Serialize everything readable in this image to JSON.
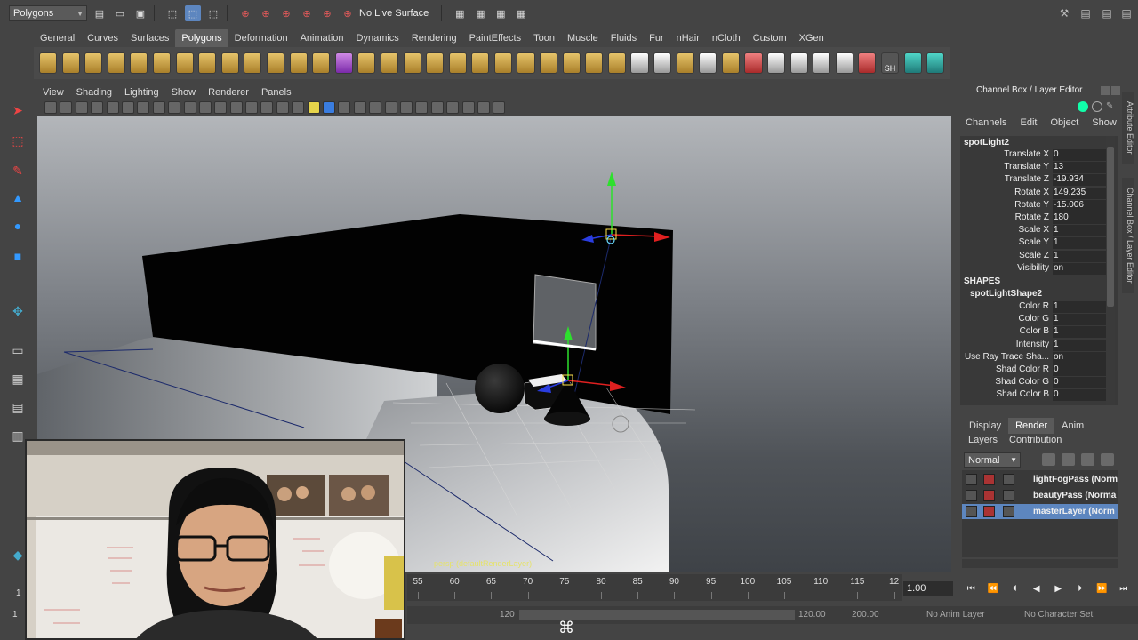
{
  "status": {
    "mode": "Polygons",
    "live_surface": "No Live Surface"
  },
  "shelf_tabs": [
    "General",
    "Curves",
    "Surfaces",
    "Polygons",
    "Deformation",
    "Animation",
    "Dynamics",
    "Rendering",
    "PaintEffects",
    "Toon",
    "Muscle",
    "Fluids",
    "Fur",
    "nHair",
    "nCloth",
    "Custom",
    "XGen"
  ],
  "shelf_active_tab": "Polygons",
  "shelf_sh_label": "SH",
  "panel_menus": [
    "View",
    "Shading",
    "Lighting",
    "Show",
    "Renderer",
    "Panels"
  ],
  "camera_label": "persp (defaultRenderLayer)",
  "channel_box": {
    "title": "Channel Box / Layer Editor",
    "menus": [
      "Channels",
      "Edit",
      "Object",
      "Show"
    ],
    "object_name": "spotLight2",
    "transform": [
      {
        "label": "Translate X",
        "value": "0"
      },
      {
        "label": "Translate Y",
        "value": "13"
      },
      {
        "label": "Translate Z",
        "value": "-19.934"
      },
      {
        "label": "Rotate X",
        "value": "149.235"
      },
      {
        "label": "Rotate Y",
        "value": "-15.006"
      },
      {
        "label": "Rotate Z",
        "value": "180"
      },
      {
        "label": "Scale X",
        "value": "1"
      },
      {
        "label": "Scale Y",
        "value": "1"
      },
      {
        "label": "Scale Z",
        "value": "1"
      },
      {
        "label": "Visibility",
        "value": "on"
      }
    ],
    "shapes_header": "SHAPES",
    "shape_name": "spotLightShape2",
    "shape_attrs": [
      {
        "label": "Color R",
        "value": "1"
      },
      {
        "label": "Color G",
        "value": "1"
      },
      {
        "label": "Color B",
        "value": "1"
      },
      {
        "label": "Intensity",
        "value": "1"
      },
      {
        "label": "Use Ray Trace Sha...",
        "value": "on"
      },
      {
        "label": "Shad Color R",
        "value": "0"
      },
      {
        "label": "Shad Color G",
        "value": "0"
      },
      {
        "label": "Shad Color B",
        "value": "0"
      }
    ],
    "side_tabs": [
      "Attribute Editor",
      "Channel Box / Layer Editor"
    ]
  },
  "layer_editor": {
    "tabs": [
      "Display",
      "Render",
      "Anim"
    ],
    "active_tab": "Render",
    "menus": [
      "Layers",
      "Contribution"
    ],
    "mode": "Normal",
    "layers": [
      {
        "name": "lightFogPass (Norm",
        "selected": false
      },
      {
        "name": "beautyPass (Norma",
        "selected": false
      },
      {
        "name": "masterLayer (Norm",
        "selected": true
      }
    ]
  },
  "timeline": {
    "ticks": [
      "55",
      "60",
      "65",
      "70",
      "75",
      "80",
      "85",
      "90",
      "95",
      "100",
      "105",
      "110",
      "115",
      "12"
    ],
    "current_time": "1.00",
    "playback_buttons": [
      "⏮",
      "⏪",
      "⏴",
      "◀",
      "▶",
      "⏵",
      "⏩",
      "⏭"
    ]
  },
  "range": {
    "start": "120",
    "end": "120.00",
    "max": "200.00",
    "anim_layer": "No Anim Layer",
    "character_set": "No Character Set"
  },
  "cmd_symbol": "⌘",
  "left_frame_label": "1",
  "left_frame_label2": "1",
  "colors": {
    "accent": "#5d86bf",
    "viewport_top": "#b3b6ba",
    "viewport_bottom": "#3e4247"
  }
}
